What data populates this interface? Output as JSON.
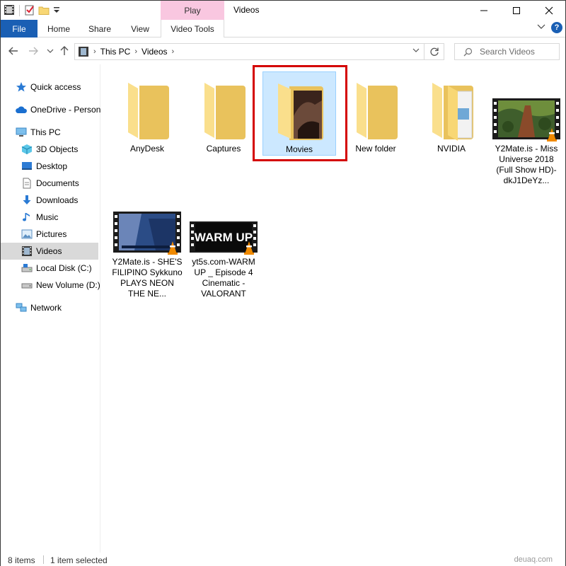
{
  "window": {
    "title": "Videos",
    "context_tab": "Play"
  },
  "ribbon": {
    "tabs": [
      "File",
      "Home",
      "Share",
      "View",
      "Video Tools"
    ]
  },
  "address": {
    "segments": [
      "This PC",
      "Videos"
    ],
    "search_placeholder": "Search Videos"
  },
  "sidebar": {
    "items": [
      {
        "label": "Quick access",
        "icon": "star-icon"
      },
      {
        "label": "OneDrive - Person",
        "icon": "cloud-icon"
      },
      {
        "label": "This PC",
        "icon": "computer-icon"
      },
      {
        "label": "3D Objects",
        "icon": "cube-icon"
      },
      {
        "label": "Desktop",
        "icon": "desktop-icon"
      },
      {
        "label": "Documents",
        "icon": "document-icon"
      },
      {
        "label": "Downloads",
        "icon": "download-icon"
      },
      {
        "label": "Music",
        "icon": "music-icon"
      },
      {
        "label": "Pictures",
        "icon": "pictures-icon"
      },
      {
        "label": "Videos",
        "icon": "video-icon"
      },
      {
        "label": "Local Disk (C:)",
        "icon": "drive-icon"
      },
      {
        "label": "New Volume (D:)",
        "icon": "drive-icon"
      },
      {
        "label": "Network",
        "icon": "network-icon"
      }
    ]
  },
  "files": [
    {
      "name": "AnyDesk",
      "kind": "folder"
    },
    {
      "name": "Captures",
      "kind": "folder"
    },
    {
      "name": "Movies",
      "kind": "folder-with-image"
    },
    {
      "name": "New folder",
      "kind": "folder"
    },
    {
      "name": "NVIDIA",
      "kind": "folder-with-files"
    },
    {
      "name": "Y2Mate.is - Miss Universe 2018 (Full Show HD)-dkJ1DeYz...",
      "kind": "video"
    },
    {
      "name": "Y2Mate.is - SHE'S FILIPINO Sykkuno PLAYS NEON THE NE...",
      "kind": "video"
    },
    {
      "name": "yt5s.com-WARM UP _ Episode 4 Cinematic - VALORANT",
      "kind": "video"
    }
  ],
  "thumb_text": {
    "warmup": "WARM UP"
  },
  "status": {
    "item_count": "8 items",
    "selection": "1 item selected",
    "watermark": "deuaq.com"
  },
  "colors": {
    "accent": "#1a5fb4",
    "play_tab": "#f9c7e0",
    "selection": "#cce8ff",
    "highlight": "#d40000",
    "folder": "#f8d775"
  }
}
